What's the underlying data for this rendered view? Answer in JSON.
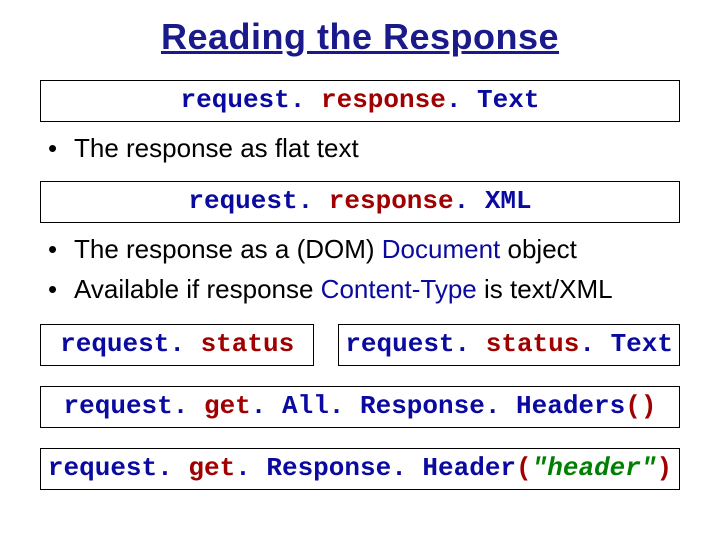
{
  "title": "Reading the Response",
  "box1": {
    "t1": "request. ",
    "t2": "response",
    "t3": ". Text"
  },
  "bullet1": "The response as flat text",
  "box2": {
    "t1": "request. ",
    "t2": "response",
    "t3": ". XML"
  },
  "bullet2_pre": "The response as a (DOM) ",
  "bullet2_doc": "Document",
  "bullet2_post": " object",
  "bullet3_pre": "Available if response ",
  "bullet3_ct": "Content-Type",
  "bullet3_post": " is text/XML",
  "box3": {
    "t1": "request. ",
    "t2": "status"
  },
  "box4": {
    "t1": "request. ",
    "t2": "status",
    "t3": ". Text"
  },
  "box5": {
    "t1": "request. ",
    "t2": "get",
    "t3": ". All. Response. Headers",
    "t4": "()"
  },
  "box6": {
    "t1": "request. ",
    "t2": "get",
    "t3": ". Response. Header",
    "t4": "(",
    "t5": "\"header\"",
    "t6": ")"
  }
}
